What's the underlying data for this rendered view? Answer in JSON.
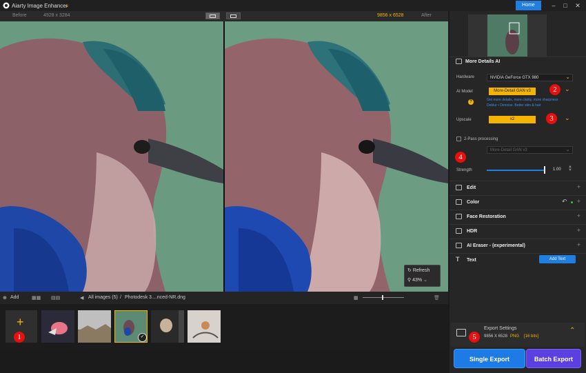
{
  "app": {
    "title": "Aiarty Image Enhancer",
    "home_label": "Home"
  },
  "compare": {
    "before_label": "Before",
    "before_size": "4928 x 3284",
    "after_size": "9856 x 6528",
    "after_label": "After"
  },
  "viewer": {
    "refresh_label": "Refresh",
    "zoom": "43%"
  },
  "thumbs": {
    "add_label": "Add",
    "all_images": "All images (5)",
    "sep": "/",
    "filename": "Photodesk 3....nced-NR.dng"
  },
  "panel": {
    "section_title": "More Details AI",
    "hardware_label": "Hardware",
    "hardware_value": "NVIDIA GeForce GTX 980",
    "ai_model_label": "AI Model",
    "ai_model_value": "More-Detail GAN  v3",
    "ai_model_desc_1": "Get more details, more clarity, more sharpness",
    "ai_model_desc_2": "Deblur • Denoise. Better skin & hair",
    "help_glyph": "?",
    "upscale_label": "Upscale",
    "upscale_value": "x2",
    "two_pass_label": "2-Pass processing",
    "two_pass_model": "More-Detail GAN  v3",
    "strength_label": "Strength",
    "strength_value": "1.00",
    "strength_fraction": 1.0,
    "edit_label": "Edit",
    "color_label": "Color",
    "face_label": "Face Restoration",
    "hdr_label": "HDR",
    "eraser_label": "AI Eraser - (experimental)",
    "text_label": "Text",
    "add_text_label": "Add Text",
    "export_settings_label": "Export Settings",
    "export_size": "9856 X 6528",
    "export_format": "PNG",
    "export_bits": "[16 bits]",
    "single_export_label": "Single Export",
    "batch_export_label": "Batch Export"
  },
  "markers": {
    "m1": "1",
    "m2": "2",
    "m3": "3",
    "m4": "4",
    "m5": "5"
  },
  "colors": {
    "accent": "#f5b400",
    "primary": "#1f7ee0",
    "batch": "#5b3fe0",
    "marker": "#e8100e"
  },
  "icons": [
    "app-logo-icon",
    "chevron-down-icon",
    "minimize-icon",
    "maximize-icon",
    "close-icon",
    "refresh-icon",
    "zoom-icon",
    "grid-icon",
    "film-icon",
    "back-icon",
    "image-icon",
    "trash-icon",
    "plus-icon",
    "undo-icon",
    "checkmark-icon"
  ]
}
